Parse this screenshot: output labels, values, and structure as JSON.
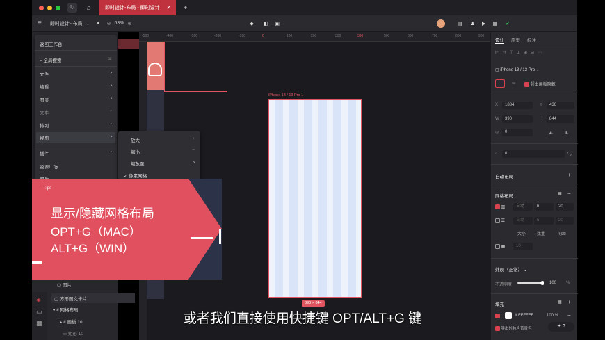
{
  "titlebar": {
    "doc_tab": "即时设计-布局 - 即时设计",
    "close": "✕",
    "plus": "+"
  },
  "toolbar": {
    "doc_name": "即时设计--布局",
    "zoom": "63%"
  },
  "menu": {
    "back": "返回工作台",
    "search": "全局搜索",
    "items": [
      "文件",
      "编辑",
      "图层",
      "文本",
      "排列",
      "视图",
      "插件",
      "资源广场",
      "帮助"
    ]
  },
  "submenu": {
    "items": [
      "放大",
      "缩小",
      "缩放至",
      "像素网格"
    ],
    "shortcut_zoom_in": "+",
    "shortcut_zoom_out": "−"
  },
  "layers": {
    "images": "图片",
    "card": "方形图文卡片",
    "grid_layout": "网格布局",
    "panel": "画板 10",
    "rect": "矩形 10"
  },
  "canvas": {
    "ruler_top": [
      "-500",
      "-400",
      "-300",
      "-200",
      "-100",
      "0",
      "100",
      "200",
      "300",
      "390",
      "500",
      "600",
      "700",
      "800",
      "900"
    ],
    "frame_label": "iPhone 13 / 13 Pro 1",
    "size_label": "390 × 844"
  },
  "banner": {
    "tips": "Tips",
    "line1": "显示/隐藏网格布局",
    "line2": "OPT+G（MAC）",
    "line3": "ALT+G（WIN）"
  },
  "right_panel": {
    "tabs": [
      "设计",
      "原型",
      "标注"
    ],
    "device": "iPhone 13 / 13 Pro",
    "clip": "超出画板隐藏",
    "x": "1884",
    "y": "436",
    "w": "390",
    "h": "844",
    "rotation": "0",
    "radius": "0",
    "auto_layout": "自动布局",
    "grid_layout": "网格布局",
    "grid_row1": {
      "type": "自动",
      "count": "6",
      "gap": "20"
    },
    "grid_row2": {
      "type": "自动",
      "count": "5",
      "gap": "20"
    },
    "grid_headers": [
      "大小",
      "数量",
      "间距"
    ],
    "grid_row3": "10",
    "appearance": "外观（正常）",
    "opacity_label": "不透明度",
    "opacity": "100",
    "percent": "%",
    "fill": "填充",
    "fill_hex": "FFFFFF",
    "fill_opacity": "100",
    "export_bg": "导出时包含背景色"
  },
  "subtitle": "或者我们直接使用快捷键 OPT/ALT+G 键",
  "colors": {
    "accent": "#d8434f",
    "banner_red": "#e0505e",
    "banner_navy": "#2c3348"
  }
}
